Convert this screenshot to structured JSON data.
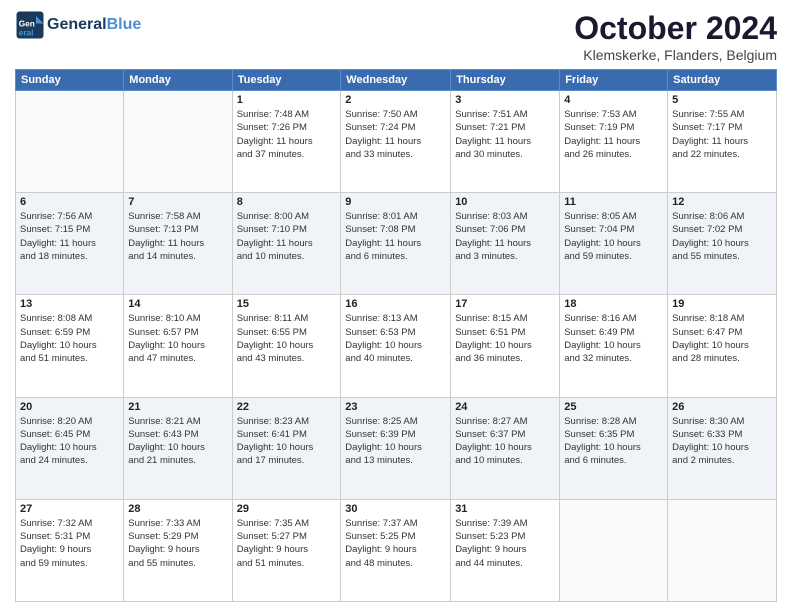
{
  "header": {
    "logo_line1": "General",
    "logo_line2": "Blue",
    "month_title": "October 2024",
    "subtitle": "Klemskerke, Flanders, Belgium"
  },
  "days_of_week": [
    "Sunday",
    "Monday",
    "Tuesday",
    "Wednesday",
    "Thursday",
    "Friday",
    "Saturday"
  ],
  "weeks": [
    [
      {
        "day": "",
        "info": ""
      },
      {
        "day": "",
        "info": ""
      },
      {
        "day": "1",
        "info": "Sunrise: 7:48 AM\nSunset: 7:26 PM\nDaylight: 11 hours\nand 37 minutes."
      },
      {
        "day": "2",
        "info": "Sunrise: 7:50 AM\nSunset: 7:24 PM\nDaylight: 11 hours\nand 33 minutes."
      },
      {
        "day": "3",
        "info": "Sunrise: 7:51 AM\nSunset: 7:21 PM\nDaylight: 11 hours\nand 30 minutes."
      },
      {
        "day": "4",
        "info": "Sunrise: 7:53 AM\nSunset: 7:19 PM\nDaylight: 11 hours\nand 26 minutes."
      },
      {
        "day": "5",
        "info": "Sunrise: 7:55 AM\nSunset: 7:17 PM\nDaylight: 11 hours\nand 22 minutes."
      }
    ],
    [
      {
        "day": "6",
        "info": "Sunrise: 7:56 AM\nSunset: 7:15 PM\nDaylight: 11 hours\nand 18 minutes."
      },
      {
        "day": "7",
        "info": "Sunrise: 7:58 AM\nSunset: 7:13 PM\nDaylight: 11 hours\nand 14 minutes."
      },
      {
        "day": "8",
        "info": "Sunrise: 8:00 AM\nSunset: 7:10 PM\nDaylight: 11 hours\nand 10 minutes."
      },
      {
        "day": "9",
        "info": "Sunrise: 8:01 AM\nSunset: 7:08 PM\nDaylight: 11 hours\nand 6 minutes."
      },
      {
        "day": "10",
        "info": "Sunrise: 8:03 AM\nSunset: 7:06 PM\nDaylight: 11 hours\nand 3 minutes."
      },
      {
        "day": "11",
        "info": "Sunrise: 8:05 AM\nSunset: 7:04 PM\nDaylight: 10 hours\nand 59 minutes."
      },
      {
        "day": "12",
        "info": "Sunrise: 8:06 AM\nSunset: 7:02 PM\nDaylight: 10 hours\nand 55 minutes."
      }
    ],
    [
      {
        "day": "13",
        "info": "Sunrise: 8:08 AM\nSunset: 6:59 PM\nDaylight: 10 hours\nand 51 minutes."
      },
      {
        "day": "14",
        "info": "Sunrise: 8:10 AM\nSunset: 6:57 PM\nDaylight: 10 hours\nand 47 minutes."
      },
      {
        "day": "15",
        "info": "Sunrise: 8:11 AM\nSunset: 6:55 PM\nDaylight: 10 hours\nand 43 minutes."
      },
      {
        "day": "16",
        "info": "Sunrise: 8:13 AM\nSunset: 6:53 PM\nDaylight: 10 hours\nand 40 minutes."
      },
      {
        "day": "17",
        "info": "Sunrise: 8:15 AM\nSunset: 6:51 PM\nDaylight: 10 hours\nand 36 minutes."
      },
      {
        "day": "18",
        "info": "Sunrise: 8:16 AM\nSunset: 6:49 PM\nDaylight: 10 hours\nand 32 minutes."
      },
      {
        "day": "19",
        "info": "Sunrise: 8:18 AM\nSunset: 6:47 PM\nDaylight: 10 hours\nand 28 minutes."
      }
    ],
    [
      {
        "day": "20",
        "info": "Sunrise: 8:20 AM\nSunset: 6:45 PM\nDaylight: 10 hours\nand 24 minutes."
      },
      {
        "day": "21",
        "info": "Sunrise: 8:21 AM\nSunset: 6:43 PM\nDaylight: 10 hours\nand 21 minutes."
      },
      {
        "day": "22",
        "info": "Sunrise: 8:23 AM\nSunset: 6:41 PM\nDaylight: 10 hours\nand 17 minutes."
      },
      {
        "day": "23",
        "info": "Sunrise: 8:25 AM\nSunset: 6:39 PM\nDaylight: 10 hours\nand 13 minutes."
      },
      {
        "day": "24",
        "info": "Sunrise: 8:27 AM\nSunset: 6:37 PM\nDaylight: 10 hours\nand 10 minutes."
      },
      {
        "day": "25",
        "info": "Sunrise: 8:28 AM\nSunset: 6:35 PM\nDaylight: 10 hours\nand 6 minutes."
      },
      {
        "day": "26",
        "info": "Sunrise: 8:30 AM\nSunset: 6:33 PM\nDaylight: 10 hours\nand 2 minutes."
      }
    ],
    [
      {
        "day": "27",
        "info": "Sunrise: 7:32 AM\nSunset: 5:31 PM\nDaylight: 9 hours\nand 59 minutes."
      },
      {
        "day": "28",
        "info": "Sunrise: 7:33 AM\nSunset: 5:29 PM\nDaylight: 9 hours\nand 55 minutes."
      },
      {
        "day": "29",
        "info": "Sunrise: 7:35 AM\nSunset: 5:27 PM\nDaylight: 9 hours\nand 51 minutes."
      },
      {
        "day": "30",
        "info": "Sunrise: 7:37 AM\nSunset: 5:25 PM\nDaylight: 9 hours\nand 48 minutes."
      },
      {
        "day": "31",
        "info": "Sunrise: 7:39 AM\nSunset: 5:23 PM\nDaylight: 9 hours\nand 44 minutes."
      },
      {
        "day": "",
        "info": ""
      },
      {
        "day": "",
        "info": ""
      }
    ]
  ]
}
